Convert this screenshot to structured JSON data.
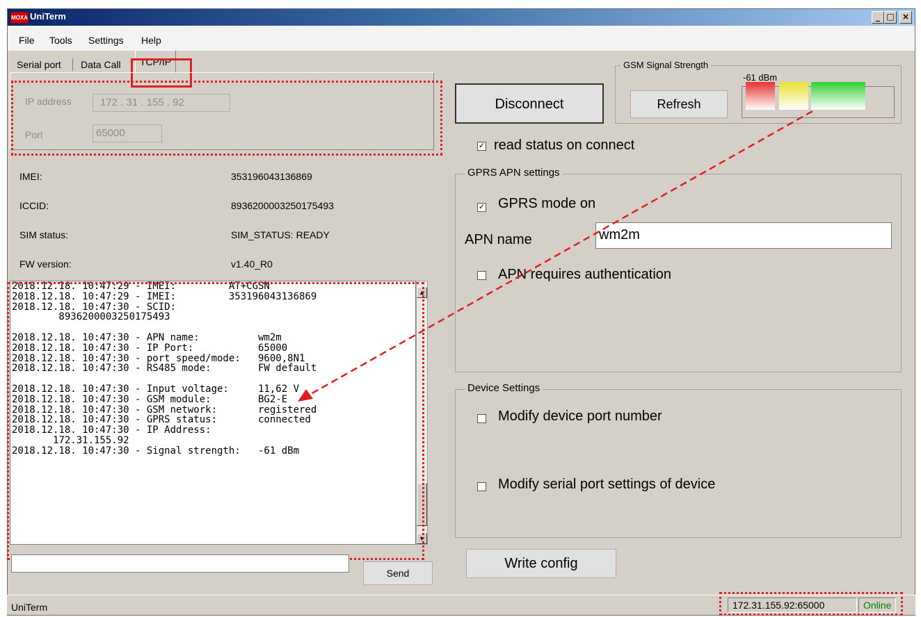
{
  "window": {
    "title": "UniTerm",
    "icon_text": "MOXA"
  },
  "menu": [
    "File",
    "Tools",
    "Settings",
    "Help"
  ],
  "tabs": {
    "serial": "Serial port",
    "datacall": "Data Call",
    "tcpip": "TCP/IP"
  },
  "connection": {
    "ip_label": "IP address",
    "ip_value": "172 . 31 . 155 . 92",
    "port_label": "Port",
    "port_value": "65000"
  },
  "info": {
    "imei_label": "IMEI:",
    "imei_value": "353196043136869",
    "iccid_label": "ICCID:",
    "iccid_value": "8936200003250175493",
    "sim_label": "SIM status:",
    "sim_value": "SIM_STATUS: READY",
    "fw_label": "FW version:",
    "fw_value": "v1.40_R0"
  },
  "log_lines": [
    "2018.12.18. 10:47:29 - IMEI:         AT+CGSN",
    "2018.12.18. 10:47:29 - IMEI:         353196043136869",
    "2018.12.18. 10:47:30 - SCID:",
    "        8936200003250175493",
    "",
    "2018.12.18. 10:47:30 - APN name:          wm2m",
    "2018.12.18. 10:47:30 - IP Port:           65000",
    "2018.12.18. 10:47:30 - port speed/mode:   9600,8N1",
    "2018.12.18. 10:47:30 - RS485 mode:        FW default",
    "",
    "2018.12.18. 10:47:30 - Input voltage:     11,62 V",
    "2018.12.18. 10:47:30 - GSM module:        BG2-E",
    "2018.12.18. 10:47:30 - GSM network:       registered",
    "2018.12.18. 10:47:30 - GPRS status:       connected",
    "2018.12.18. 10:47:30 - IP Address:",
    "       172.31.155.92",
    "2018.12.18. 10:47:30 - Signal strength:   -61 dBm"
  ],
  "command": {
    "value": "",
    "send_label": "Send"
  },
  "disconnect_label": "Disconnect",
  "gsm": {
    "title": "GSM Signal Strength",
    "dbm": "-61 dBm",
    "refresh_label": "Refresh",
    "level_bars": 3,
    "colors": [
      "#e83030",
      "#e8e030",
      "#30d030"
    ]
  },
  "read_status": {
    "label": "read status on connect",
    "checked": true
  },
  "gprs": {
    "title": "GPRS APN settings",
    "mode_label": "GPRS mode on",
    "mode_checked": true,
    "apn_label": "APN name",
    "apn_value": "wm2m",
    "auth_label": "APN requires authentication",
    "auth_checked": false
  },
  "device": {
    "title": "Device Settings",
    "port_label": "Modify device port number",
    "port_checked": false,
    "serial_label": "Modify serial port settings of device",
    "serial_checked": false
  },
  "write_config_label": "Write config",
  "status": {
    "app": "UniTerm",
    "address": "172.31.155.92:65000",
    "state": "Online",
    "state_color": "#008000"
  },
  "annotation_color": "#e02020"
}
